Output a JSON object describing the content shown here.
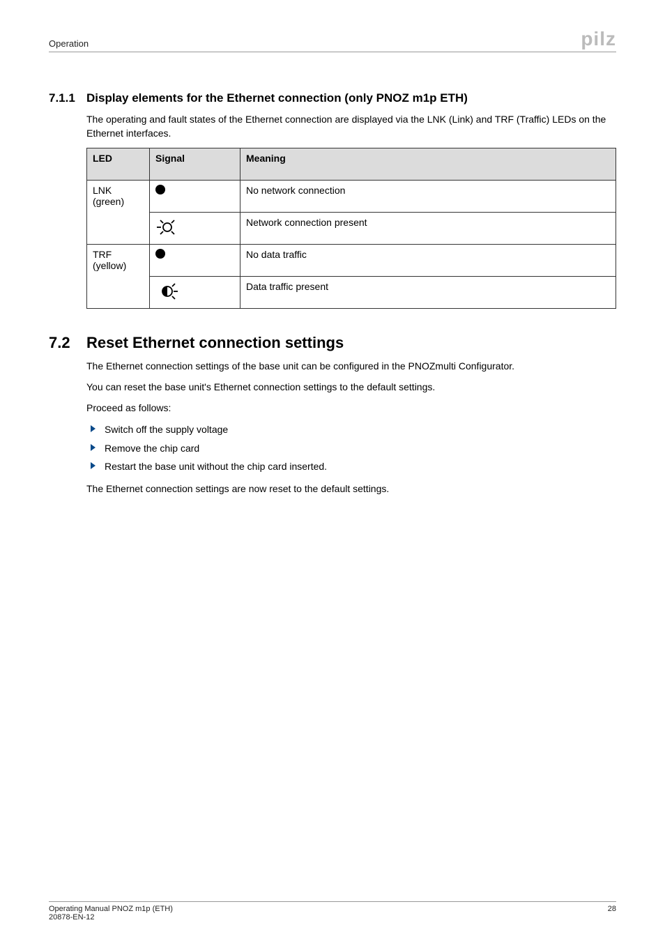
{
  "header": {
    "section_label": "Operation",
    "logo_text": "pilz"
  },
  "sec_711": {
    "number": "7.1.1",
    "title": "Display elements for the Ethernet connection (only PNOZ m1p ETH)",
    "intro": "The operating and fault states of the Ethernet connection are displayed via the LNK (Link) and TRF (Traffic) LEDs on the Ethernet interfaces.",
    "table": {
      "headers": {
        "led": "LED",
        "signal": "Signal",
        "meaning": "Meaning"
      },
      "rows": [
        {
          "led": "LNK (green)",
          "signal_icon": "led-on",
          "meaning": "No network connection"
        },
        {
          "led": "",
          "signal_icon": "led-on-rays",
          "meaning": "Network connection present"
        },
        {
          "led": "TRF (yellow)",
          "signal_icon": "led-on",
          "meaning": "No data traffic"
        },
        {
          "led": "",
          "signal_icon": "led-half-rays",
          "meaning": "Data traffic present"
        }
      ]
    }
  },
  "sec_72": {
    "number": "7.2",
    "title": "Reset Ethernet connection settings",
    "p1": "The Ethernet connection settings of the base unit can be configured in the PNOZmulti Configurator.",
    "p2": "You can reset the base unit's Ethernet connection settings to the default settings.",
    "p3": "Proceed as follows:",
    "bullets": [
      "Switch off the supply voltage",
      "Remove the chip card",
      "Restart the base unit without the chip card inserted."
    ],
    "p4": "The Ethernet connection settings are now reset to the default settings."
  },
  "footer": {
    "line1": "Operating Manual PNOZ m1p (ETH)",
    "line2": "20878-EN-12",
    "page": "28"
  }
}
